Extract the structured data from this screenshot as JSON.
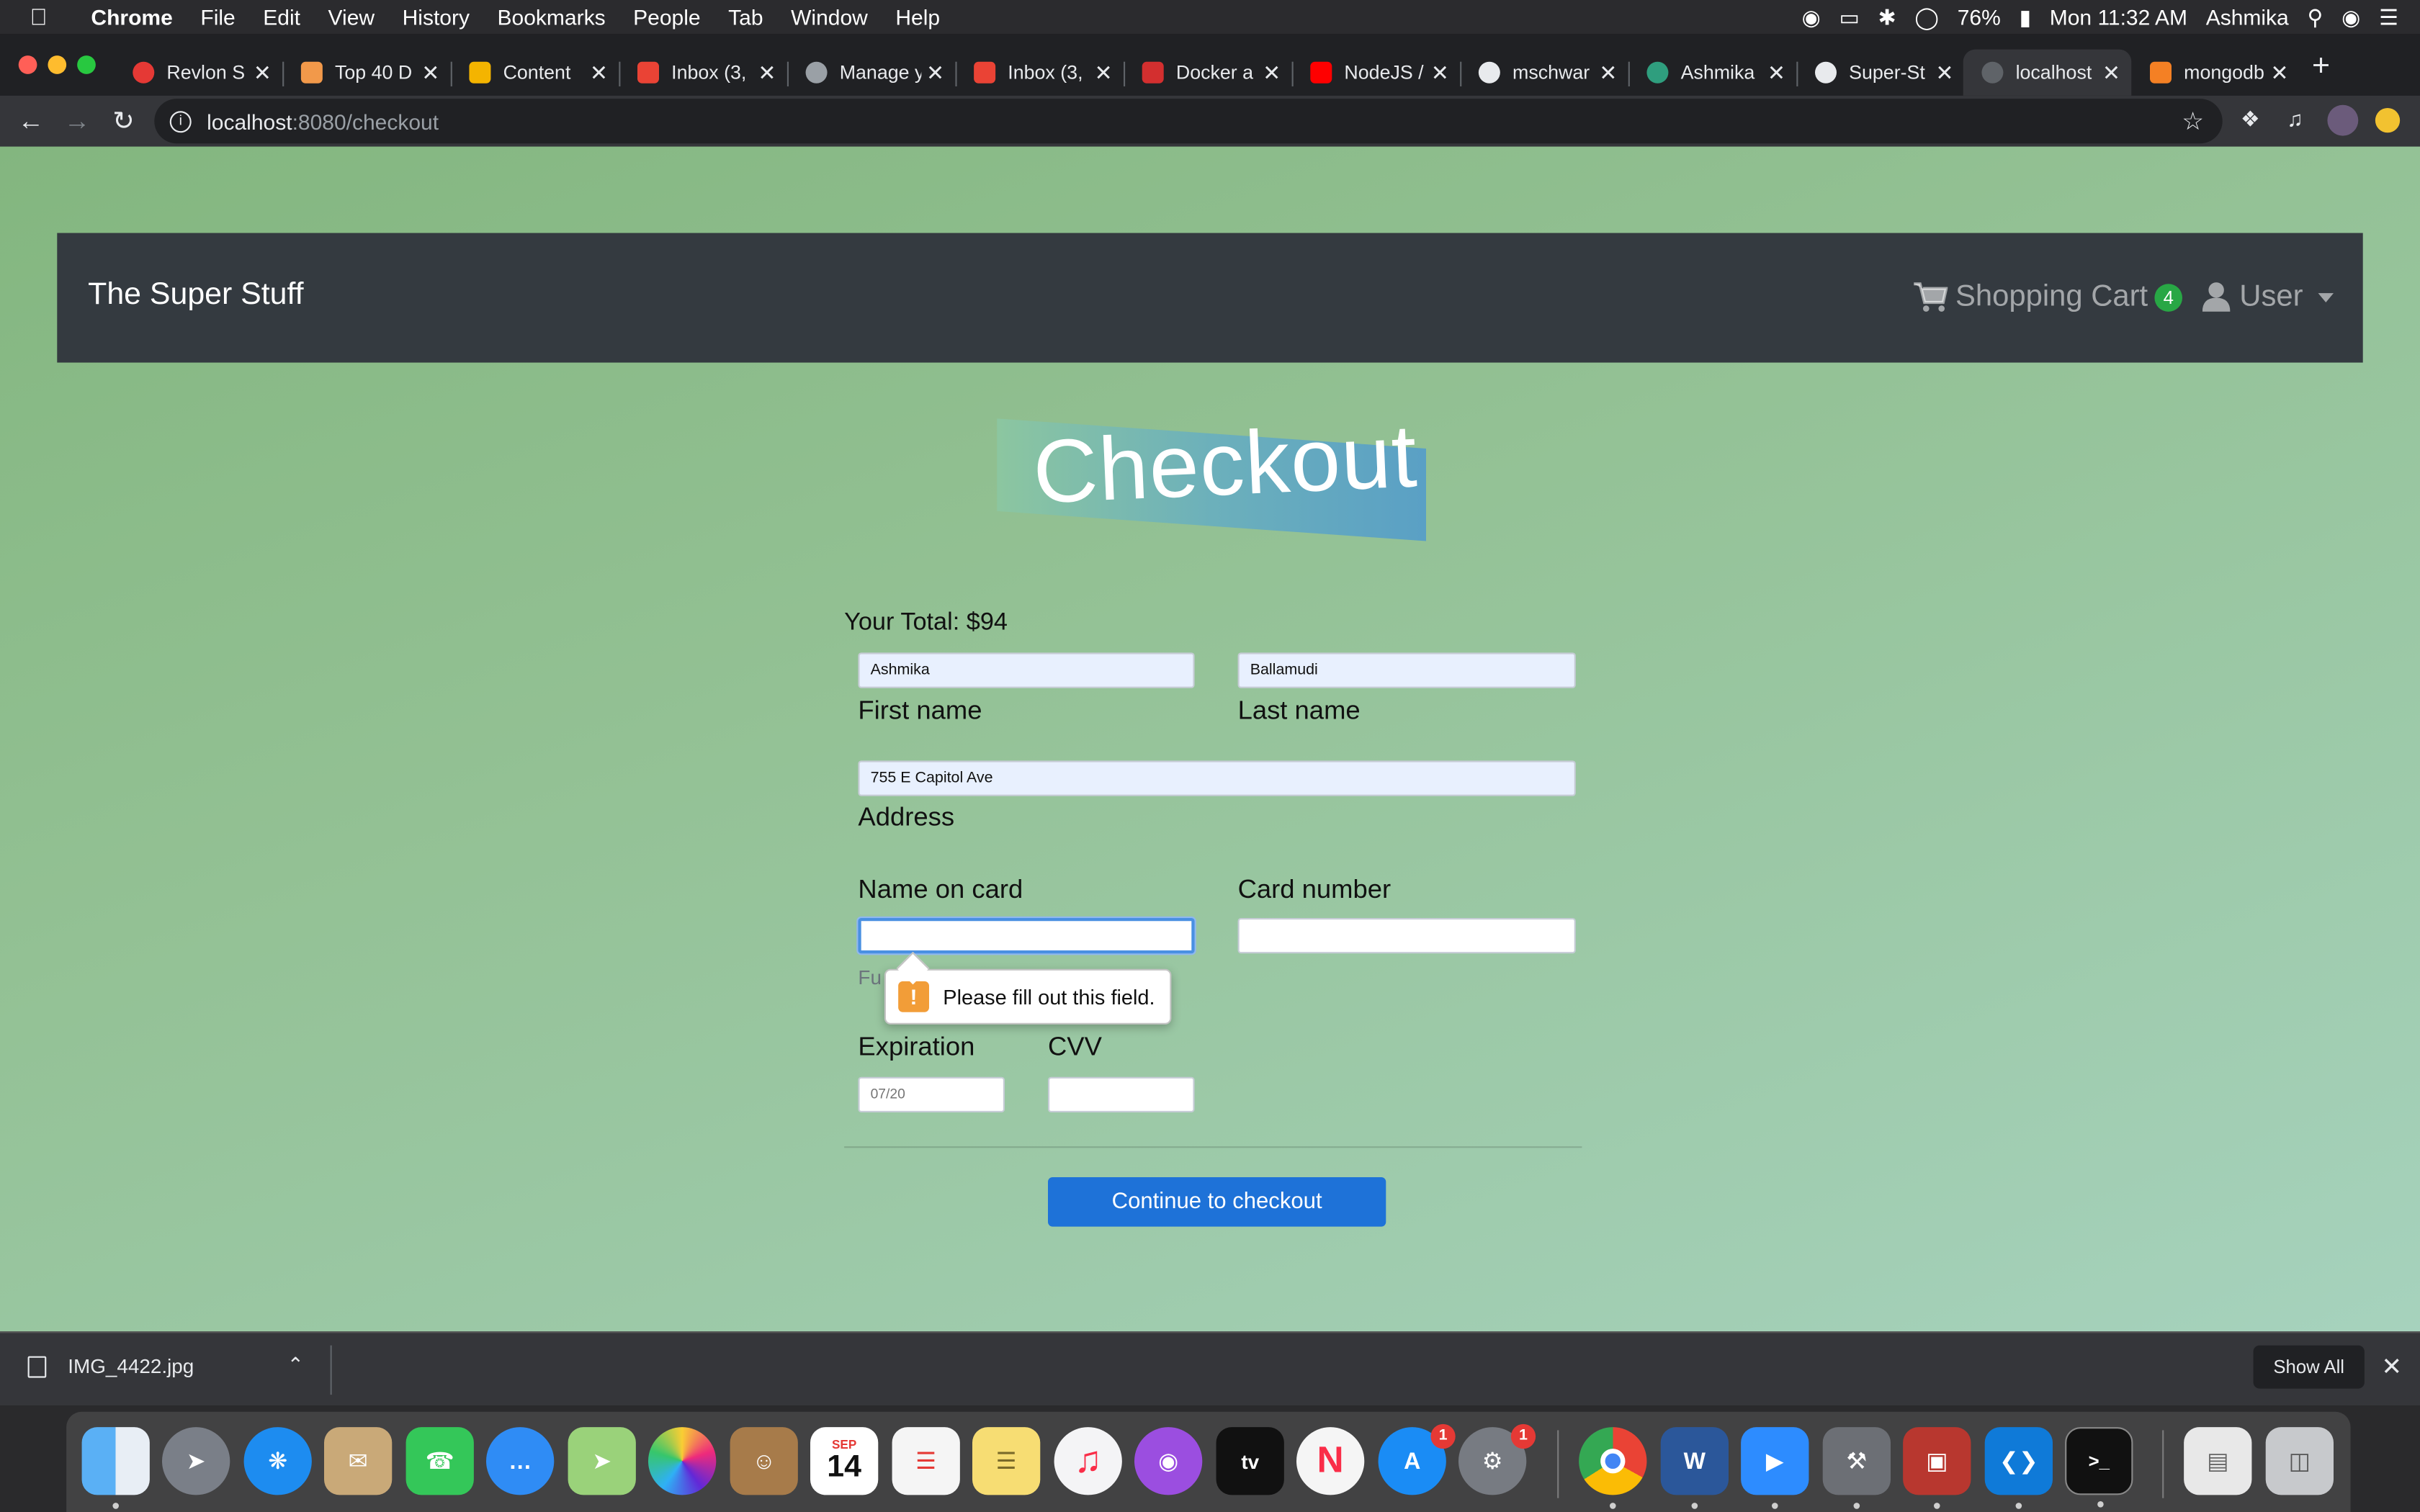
{
  "menubar": {
    "app": "Chrome",
    "items": [
      "File",
      "Edit",
      "View",
      "History",
      "Bookmarks",
      "People",
      "Tab",
      "Window",
      "Help"
    ],
    "battery": "76%",
    "clock": "Mon 11:32 AM",
    "user": "Ashmika"
  },
  "tabs": [
    {
      "title": "Revlon S",
      "color": "#e53935"
    },
    {
      "title": "Top 40 D",
      "color": "#f2994a"
    },
    {
      "title": "Content",
      "color": "#f4b400"
    },
    {
      "title": "Inbox (3,",
      "color": "#ea4335"
    },
    {
      "title": "Manage y",
      "color": "#9aa0a6"
    },
    {
      "title": "Inbox (3,",
      "color": "#ea4335"
    },
    {
      "title": "Docker a",
      "color": "#d32f2f"
    },
    {
      "title": "NodeJS /",
      "color": "#ff0000"
    },
    {
      "title": "mschwar",
      "color": "#e8eaed"
    },
    {
      "title": "Ashmika",
      "color": "#2f9e7e"
    },
    {
      "title": "Super-St",
      "color": "#e8eaed"
    },
    {
      "title": "localhost",
      "color": "#5f6368"
    },
    {
      "title": "mongodb",
      "color": "#f48024"
    }
  ],
  "url": {
    "host": "localhost",
    "path": ":8080/checkout"
  },
  "navbar": {
    "brand": "The Super Stuff",
    "cart_label": "Shopping Cart",
    "cart_count": "4",
    "user_label": "User"
  },
  "checkout": {
    "title": "Checkout",
    "total": "Your Total: $94",
    "first_name": {
      "value": "Ashmika",
      "label": "First name"
    },
    "last_name": {
      "value": "Ballamudi",
      "label": "Last name"
    },
    "address": {
      "value": "755 E Capitol Ave",
      "label": "Address"
    },
    "name_on_card": {
      "label": "Name on card",
      "value": "",
      "hint": "Fu"
    },
    "card_number": {
      "label": "Card number",
      "value": ""
    },
    "expiration": {
      "label": "Expiration",
      "placeholder": "07/20"
    },
    "cvv": {
      "label": "CVV",
      "value": ""
    },
    "validation_message": "Please fill out this field.",
    "submit_label": "Continue to checkout"
  },
  "downloads": {
    "file": "IMG_4422.jpg",
    "show_all": "Show All"
  },
  "dock": {
    "calendar_month": "SEP",
    "calendar_day": "14",
    "appstore_badge": "1",
    "settings_badge": "1",
    "tv_label": "tv"
  },
  "colors": {
    "navbar_bg": "#343a40",
    "badge_green": "#28a745",
    "button_blue": "#1e72d8",
    "page_green": "#93c194"
  }
}
